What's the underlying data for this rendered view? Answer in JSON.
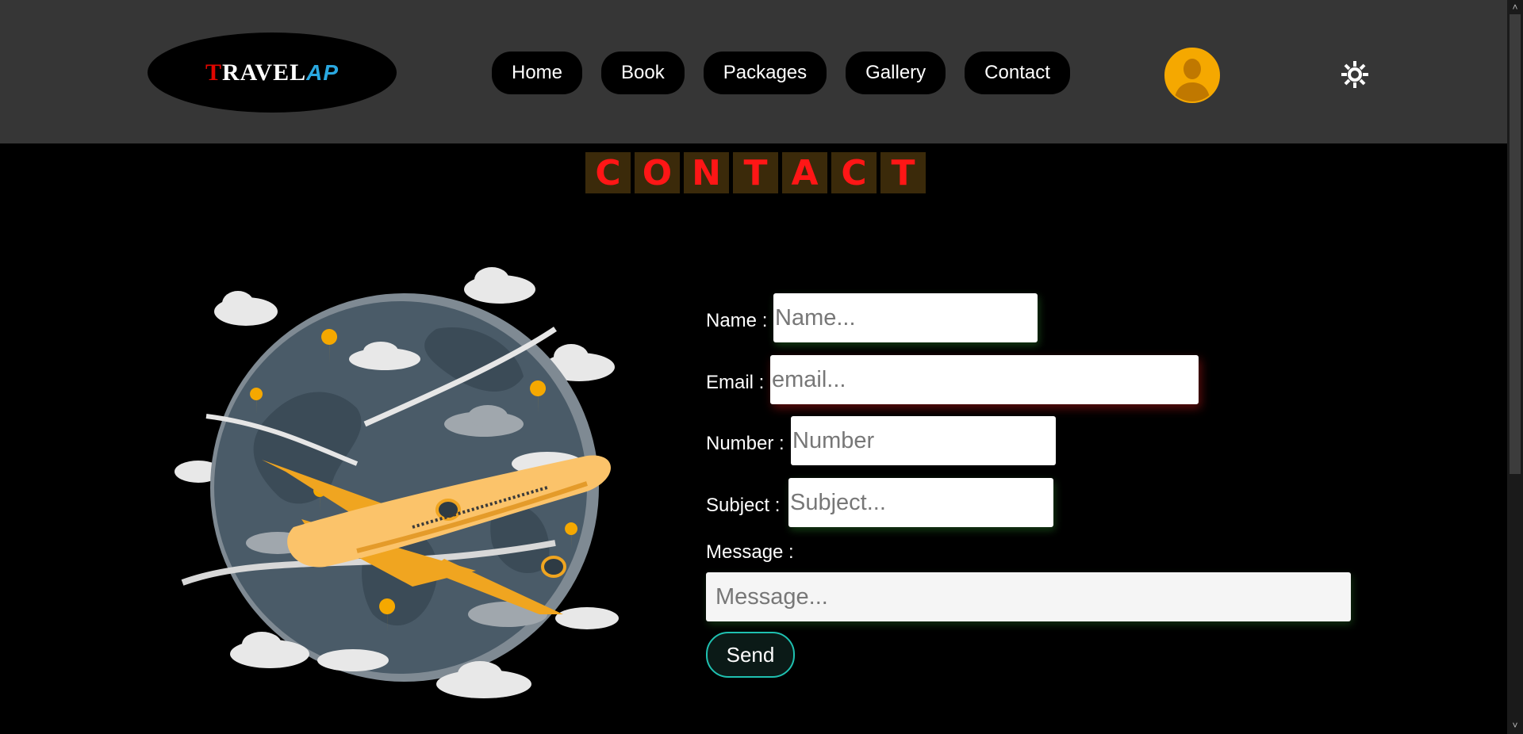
{
  "header": {
    "logo": {
      "t": "T",
      "ravel": "RAVEL",
      "ap": "AP"
    },
    "nav": [
      {
        "label": "Home"
      },
      {
        "label": "Book"
      },
      {
        "label": "Packages"
      },
      {
        "label": "Gallery"
      },
      {
        "label": "Contact"
      }
    ],
    "icons": {
      "avatar": "user-avatar-icon",
      "theme_toggle": "sun-icon"
    }
  },
  "page_title_letters": [
    "C",
    "O",
    "N",
    "T",
    "A",
    "C",
    "T"
  ],
  "form": {
    "name": {
      "label": "Name :",
      "placeholder": "Name..."
    },
    "email": {
      "label": "Email :",
      "placeholder": "email..."
    },
    "number": {
      "label": "Number :",
      "placeholder": "Number"
    },
    "subject": {
      "label": "Subject :",
      "placeholder": "Subject..."
    },
    "message": {
      "label": "Message :",
      "placeholder": "Message..."
    },
    "send_label": "Send"
  },
  "colors": {
    "header_bg": "#363636",
    "page_bg": "#000000",
    "accent_orange": "#f5a800",
    "title_red": "#ff1616",
    "send_border": "#1fc0b0"
  }
}
